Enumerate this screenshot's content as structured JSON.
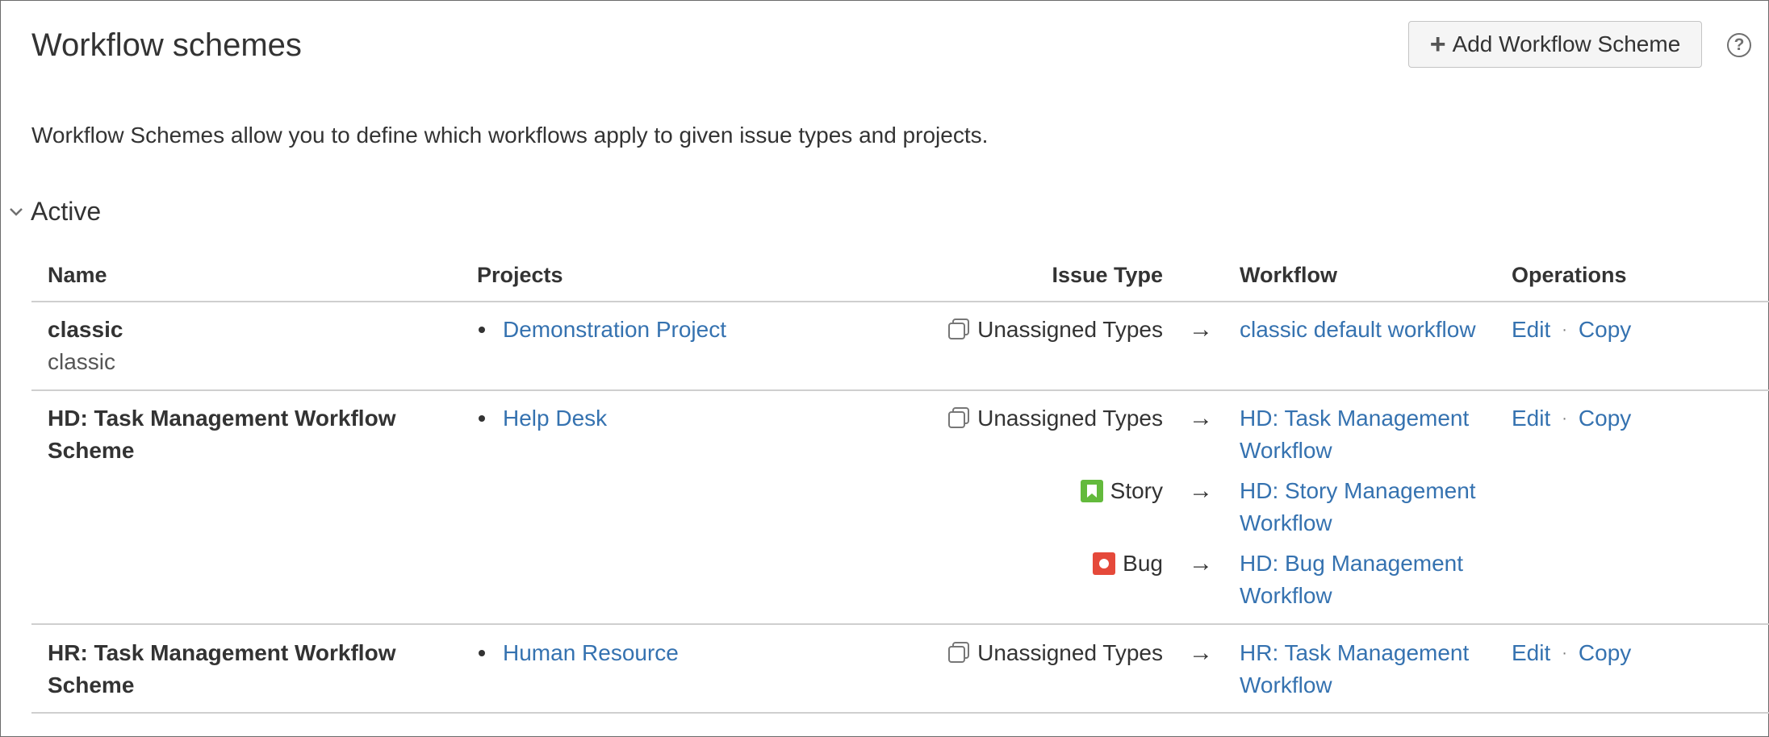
{
  "header": {
    "title": "Workflow schemes",
    "add_button_label": "Add Workflow Scheme",
    "help_symbol": "?"
  },
  "description": "Workflow Schemes allow you to define which workflows apply to given issue types and projects.",
  "section": {
    "label": "Active",
    "columns": [
      "Name",
      "Projects",
      "Issue Type",
      "Workflow",
      "Operations"
    ]
  },
  "rows": [
    {
      "name": "classic",
      "description": "classic",
      "project": "Demonstration Project",
      "mappings": [
        {
          "issue_type": "Unassigned Types",
          "icon": "unassigned-types-icon",
          "workflow": "classic default workflow"
        }
      ],
      "ops": {
        "edit": "Edit",
        "copy": "Copy"
      }
    },
    {
      "name": "HD: Task Management Workflow Scheme",
      "name_lines": [
        "HD: Task Management Workflow",
        "Scheme"
      ],
      "project": "Help Desk",
      "mappings": [
        {
          "issue_type": "Unassigned Types",
          "icon": "unassigned-types-icon",
          "workflow": "HD: Task Management Workflow",
          "workflow_lines": [
            "HD: Task Management",
            "Workflow"
          ]
        },
        {
          "issue_type": "Story",
          "icon": "story-icon",
          "workflow": "HD: Story Management Workflow",
          "workflow_lines": [
            "HD: Story Management",
            "Workflow"
          ]
        },
        {
          "issue_type": "Bug",
          "icon": "bug-icon",
          "workflow": "HD: Bug Management Workflow",
          "workflow_lines": [
            "HD: Bug Management",
            "Workflow"
          ]
        }
      ],
      "ops": {
        "edit": "Edit",
        "copy": "Copy"
      }
    },
    {
      "name": "HR: Task Management Workflow Scheme",
      "name_lines": [
        "HR: Task Management Workflow",
        "Scheme"
      ],
      "project": "Human Resource",
      "mappings": [
        {
          "issue_type": "Unassigned Types",
          "icon": "unassigned-types-icon",
          "workflow": "HR: Task Management Workflow",
          "workflow_lines": [
            "HR: Task Management",
            "Workflow"
          ]
        }
      ],
      "ops": {
        "edit": "Edit",
        "copy": "Copy"
      }
    }
  ],
  "arrow_symbol": "→",
  "ops_separator": "·",
  "colors": {
    "link": "#3572b0",
    "story": "#63ba3c",
    "bug": "#e5493a",
    "button_bg": "#f5f5f5"
  }
}
